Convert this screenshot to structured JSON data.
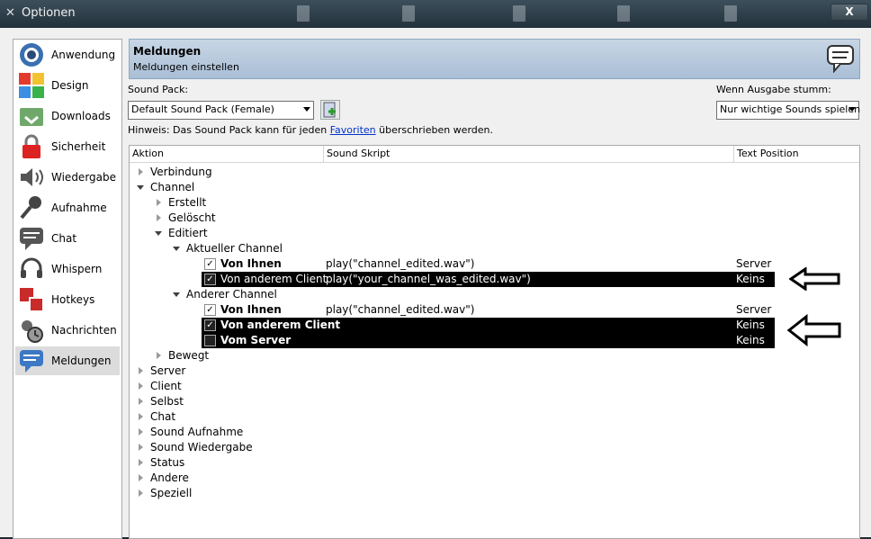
{
  "window": {
    "title": "Optionen",
    "close_label": "X"
  },
  "sidebar": {
    "items": [
      {
        "label": "Anwendung",
        "icon": "teamspeak-icon"
      },
      {
        "label": "Design",
        "icon": "design-icon"
      },
      {
        "label": "Downloads",
        "icon": "downloads-icon"
      },
      {
        "label": "Sicherheit",
        "icon": "lock-icon"
      },
      {
        "label": "Wiedergabe",
        "icon": "speaker-icon"
      },
      {
        "label": "Aufnahme",
        "icon": "microphone-icon"
      },
      {
        "label": "Chat",
        "icon": "chat-icon"
      },
      {
        "label": "Whispern",
        "icon": "headset-icon"
      },
      {
        "label": "Hotkeys",
        "icon": "hotkeys-icon"
      },
      {
        "label": "Nachrichten",
        "icon": "messages-icon"
      },
      {
        "label": "Meldungen",
        "icon": "notifications-icon",
        "active": true
      }
    ]
  },
  "header": {
    "title": "Meldungen",
    "subtitle": "Meldungen einstellen",
    "icon": "notifications-icon"
  },
  "soundpack": {
    "label": "Sound Pack:",
    "value": "Default Sound Pack (Female)",
    "mute_label": "Wenn Ausgabe stumm:",
    "mute_value": "Nur wichtige Sounds spielen"
  },
  "hint": {
    "prefix": "Hinweis: Das Sound Pack kann für jeden ",
    "link": "Favoriten",
    "suffix": " überschrieben werden."
  },
  "tree": {
    "columns": [
      "Aktion",
      "Sound Skript",
      "Text Position"
    ],
    "rows": [
      {
        "label": "Verbindung"
      },
      {
        "label": "Channel"
      },
      {
        "label": "Erstellt"
      },
      {
        "label": "Gelöscht"
      },
      {
        "label": "Editiert"
      },
      {
        "label": "Aktueller Channel"
      },
      {
        "label": "Von Ihnen",
        "script": "play(\"channel_edited.wav\")",
        "pos": "Server"
      },
      {
        "label": "Von anderem Client",
        "script": "play(\"your_channel_was_edited.wav\")",
        "pos": "Keins"
      },
      {
        "label": "Anderer Channel"
      },
      {
        "label": "Von Ihnen",
        "script": "play(\"channel_edited.wav\")",
        "pos": "Server"
      },
      {
        "label": "Von anderem Client",
        "script": "",
        "pos": "Keins"
      },
      {
        "label": "Vom Server",
        "script": "",
        "pos": "Keins"
      },
      {
        "label": "Bewegt"
      },
      {
        "label": "Server"
      },
      {
        "label": "Client"
      },
      {
        "label": "Selbst"
      },
      {
        "label": "Chat"
      },
      {
        "label": "Sound Aufnahme"
      },
      {
        "label": "Sound Wiedergabe"
      },
      {
        "label": "Status"
      },
      {
        "label": "Andere"
      },
      {
        "label": "Speziell"
      }
    ]
  }
}
